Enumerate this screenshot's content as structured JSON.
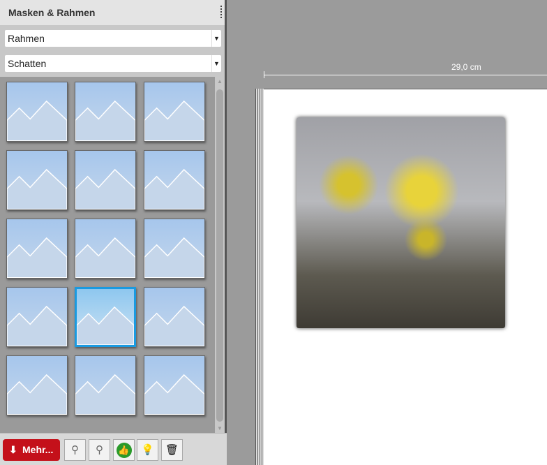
{
  "panel": {
    "title": "Masken & Rahmen",
    "dropdown1": "Rahmen",
    "dropdown2": "Schatten",
    "selected_index": 10,
    "thumbnail_count": 15
  },
  "toolbar": {
    "more_label": "Mehr...",
    "zoom_out": "zoom-out",
    "zoom_in": "zoom-in",
    "apply": "thumbs-up",
    "tip": "lightbulb",
    "delete": "trash"
  },
  "canvas": {
    "ruler_label": "29,0 cm"
  },
  "colors": {
    "accent": "#1a9ae0",
    "more_button": "#c4101a"
  }
}
